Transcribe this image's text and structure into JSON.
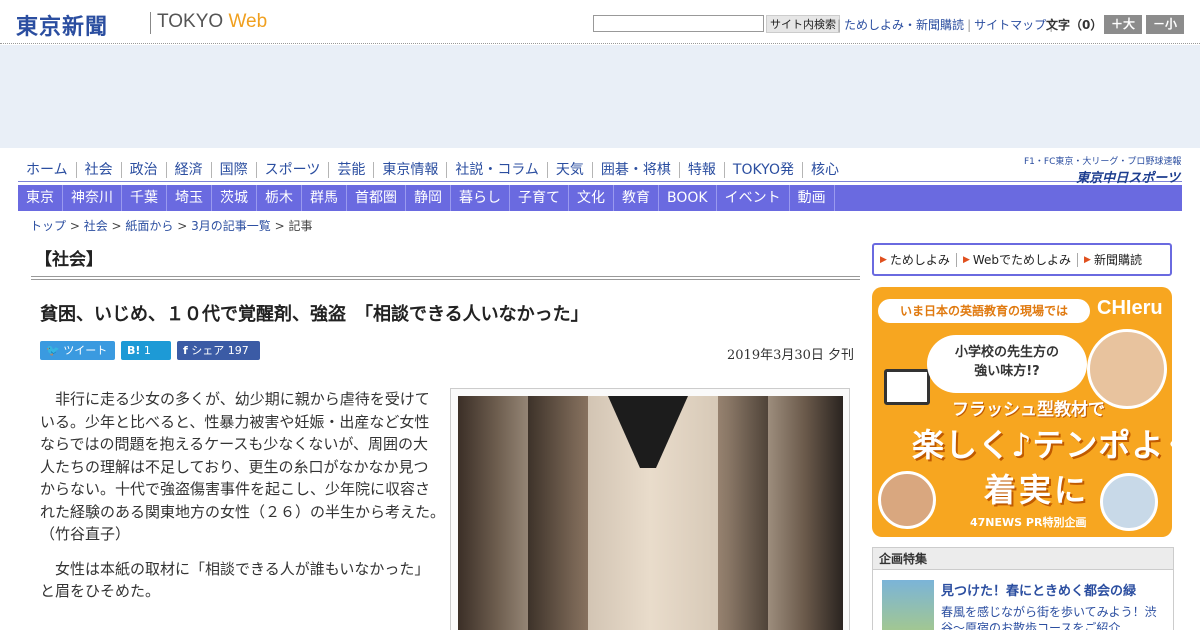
{
  "header": {
    "logo_jp": "東京新聞",
    "logo_tokyo": "TOKYO",
    "logo_web": "Web",
    "search_button": "サイト内検索",
    "links": [
      "ためしよみ・新聞購読",
      "サイトマップ"
    ],
    "font_size_label": "文字（0）",
    "font_up": "＋大",
    "font_down": "－小"
  },
  "main_nav": [
    "ホーム",
    "社会",
    "政治",
    "経済",
    "国際",
    "スポーツ",
    "芸能",
    "東京情報",
    "社説・コラム",
    "天気",
    "囲碁・将棋",
    "特報",
    "TOKYO発",
    "核心"
  ],
  "chunichi": {
    "small": "F1・FC東京・大リーグ・プロ野球速報",
    "big": "東京中日スポーツ"
  },
  "sub_nav": [
    "東京",
    "神奈川",
    "千葉",
    "埼玉",
    "茨城",
    "栃木",
    "群馬",
    "首都圏",
    "静岡",
    "暮らし",
    "子育て",
    "文化",
    "教育",
    "BOOK",
    "イベント",
    "動画"
  ],
  "breadcrumb": {
    "items": [
      "トップ",
      "社会",
      "紙面から",
      "3月の記事一覧"
    ],
    "sep": " > ",
    "current": "記事"
  },
  "section_title": "【社会】",
  "article": {
    "title": "貧困、いじめ、１０代で覚醒剤、強盗　「相談できる人いなかった」",
    "date": "2019年3月30日 夕刊",
    "paragraphs": [
      "非行に走る少女の多くが、幼少期に親から虐待を受けている。少年と比べると、性暴力被害や妊娠・出産など女性ならではの問題を抱えるケースも少なくないが、周囲の大人たちの理解は不足しており、更生の糸口がなかなか見つからない。十代で強盗傷害事件を起こし、少年院に収容された経験のある関東地方の女性（２６）の半生から考えた。　（竹谷直子）",
      "女性は本紙の取材に「相談できる人が誰もいなかった」と眉をひそめた。"
    ]
  },
  "share": {
    "tweet": "ツイート",
    "hatena_icon": "B!",
    "hatena_count": "1",
    "fb_label": "シェア",
    "fb_count": "197"
  },
  "sidebar": {
    "subscribe": [
      "ためしよみ",
      "Webでためしよみ",
      "新聞購読"
    ],
    "promo": {
      "top": "いま日本の英語教育の現場では",
      "brand": "CHIeru",
      "bubble_line1": "小学校の先生方の",
      "bubble_line2": "強い味方!?",
      "mid": "フラッシュ型教材で",
      "big1": "楽しく♪テンポよく",
      "big2": "着実に",
      "foot": "47NEWS PR特別企画"
    },
    "feature": {
      "heading": "企画特集",
      "title": "見つけた！春にときめく都会の緑",
      "desc": "春風を感じながら街を歩いてみよう！渋谷～原宿のお散歩コースをご紹介"
    }
  },
  "colors": {
    "brand_blue": "#2b4ea0",
    "subnav_bg": "#6a6ae0",
    "promo_orange": "#f7a620"
  }
}
